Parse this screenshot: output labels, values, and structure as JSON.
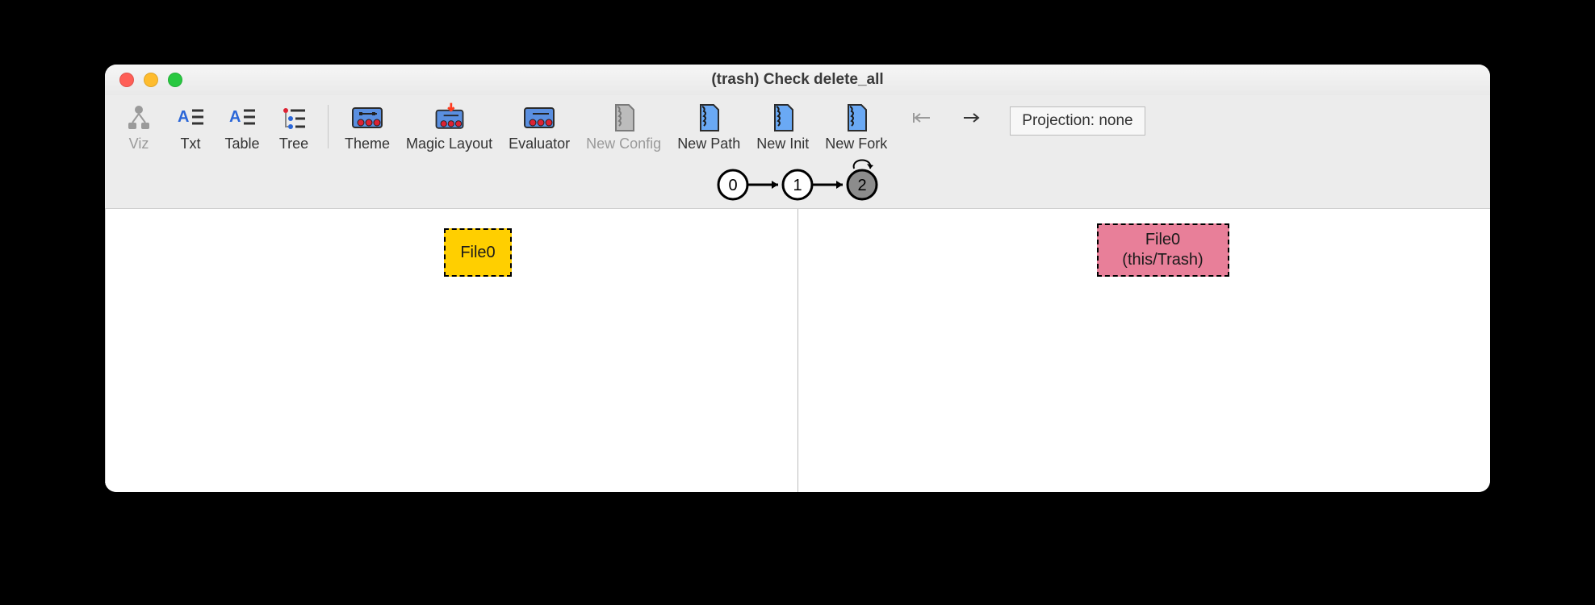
{
  "title": "(trash) Check delete_all",
  "toolbar": {
    "viz": "Viz",
    "txt": "Txt",
    "table": "Table",
    "tree": "Tree",
    "theme": "Theme",
    "magic_layout": "Magic Layout",
    "evaluator": "Evaluator",
    "new_config": "New Config",
    "new_path": "New Path",
    "new_init": "New Init",
    "new_fork": "New Fork"
  },
  "projection_label": "Projection: none",
  "trace": {
    "steps": [
      "0",
      "1",
      "2"
    ],
    "current": 2,
    "loopback_from": 2
  },
  "panes": {
    "left": {
      "node": {
        "label1": "File0",
        "label2": null,
        "color": "yellow"
      }
    },
    "right": {
      "node": {
        "label1": "File0",
        "label2": "(this/Trash)",
        "color": "pink"
      }
    }
  }
}
